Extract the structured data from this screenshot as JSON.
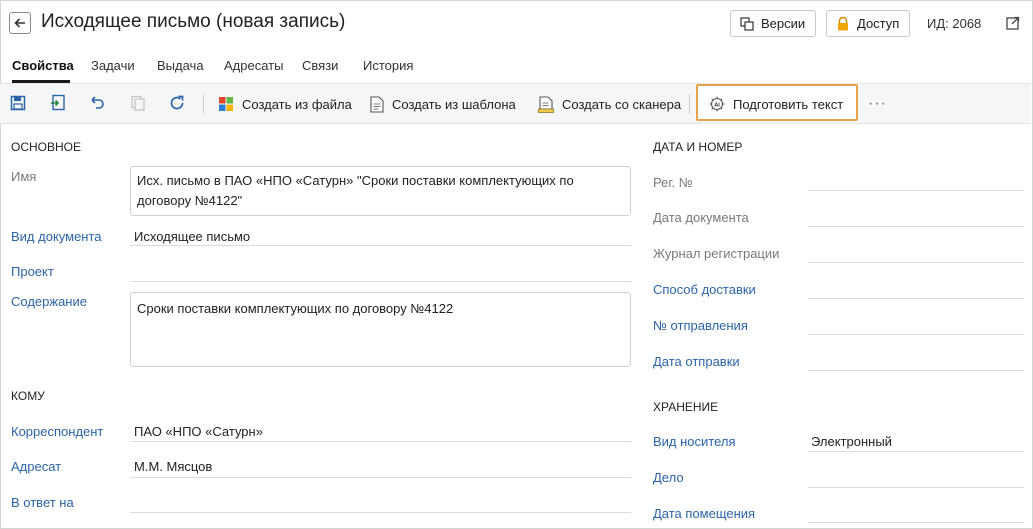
{
  "header": {
    "title": "Исходящее письмо (новая запись)",
    "versions_label": "Версии",
    "access_label": "Доступ",
    "id_label": "ИД: 2068"
  },
  "tabs": [
    {
      "label": "Свойства",
      "active": true
    },
    {
      "label": "Задачи"
    },
    {
      "label": "Выдача"
    },
    {
      "label": "Адресаты"
    },
    {
      "label": "Связи"
    },
    {
      "label": "История"
    }
  ],
  "toolbar": {
    "create_from_file": "Создать из файла",
    "create_from_template": "Создать из шаблона",
    "create_from_scanner": "Создать со сканера",
    "prepare_text": "Подготовить текст",
    "more": "···"
  },
  "main_section": {
    "title": "ОСНОВНОЕ",
    "name_label": "Имя",
    "name_value": "Исх. письмо в ПАО «НПО «Сатурн» \"Сроки поставки комплектующих по договору №4122\"",
    "doc_kind_label": "Вид документа",
    "doc_kind_value": "Исходящее письмо",
    "project_label": "Проект",
    "content_label": "Содержание",
    "content_value": "Сроки поставки комплектующих по договору №4122"
  },
  "to_section": {
    "title": "КОМУ",
    "correspondent_label": "Корреспондент",
    "correspondent_value": "ПАО «НПО «Сатурн»",
    "addressee_label": "Адресат",
    "addressee_value": "М.М. Мясцов",
    "reply_to_label": "В ответ на"
  },
  "date_section": {
    "title": "ДАТА И НОМЕР",
    "reg_no_label": "Рег. №",
    "doc_date_label": "Дата документа",
    "journal_label": "Журнал регистрации",
    "delivery_method_label": "Способ доставки",
    "dispatch_no_label": "№ отправления",
    "dispatch_date_label": "Дата отправки"
  },
  "storage_section": {
    "title": "ХРАНЕНИЕ",
    "medium_label": "Вид носителя",
    "medium_value": "Электронный",
    "case_label": "Дело",
    "placement_date_label": "Дата помещения"
  },
  "colors": {
    "link": "#2b64a8",
    "highlight": "#e9a24c",
    "toolbar_bg": "#f5f6f7"
  }
}
